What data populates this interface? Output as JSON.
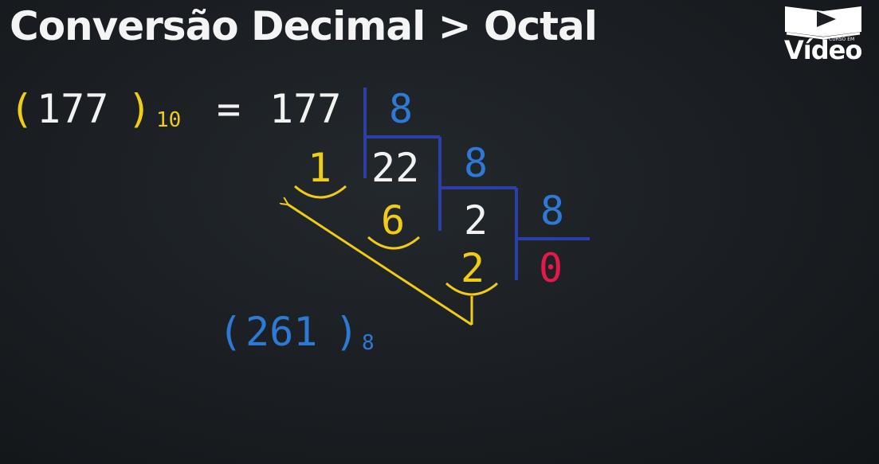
{
  "title": "Conversão Decimal > Octal",
  "logo": {
    "brand": "Vídeo",
    "tagline": "CURSO EM"
  },
  "equation": {
    "open_paren": "(",
    "number": "177",
    "close_paren": ")",
    "base": "10",
    "equals": "=",
    "dividend": "177"
  },
  "division": {
    "divisor": "8",
    "quotients": [
      "22",
      "2",
      "0"
    ],
    "remainders": [
      "1",
      "6",
      "2"
    ]
  },
  "result": {
    "open_paren": "(",
    "value": "261",
    "close_paren": ")",
    "base": "8"
  },
  "colors": {
    "yellow": "#f1cc14",
    "blue": "#2f79d6",
    "navy": "#2c3ea8",
    "red": "#e5184a",
    "white": "#f2f2f2"
  }
}
